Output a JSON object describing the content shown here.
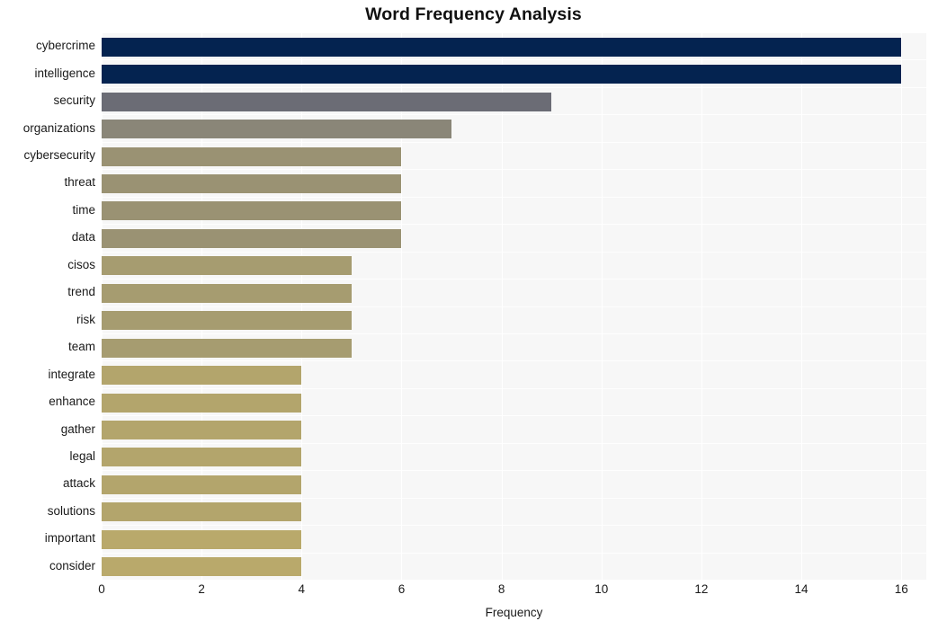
{
  "chart_data": {
    "type": "bar",
    "orientation": "horizontal",
    "title": "Word Frequency Analysis",
    "xlabel": "Frequency",
    "ylabel": "",
    "xlim": [
      0,
      16.5
    ],
    "xticks": [
      0,
      2,
      4,
      6,
      8,
      10,
      12,
      14,
      16
    ],
    "xtick_labels": [
      "0",
      "2",
      "4",
      "6",
      "8",
      "10",
      "12",
      "14",
      "16"
    ],
    "grid": true,
    "legend": null,
    "categories": [
      "cybercrime",
      "intelligence",
      "security",
      "organizations",
      "cybersecurity",
      "threat",
      "time",
      "data",
      "cisos",
      "trend",
      "risk",
      "team",
      "integrate",
      "enhance",
      "gather",
      "legal",
      "attack",
      "solutions",
      "important",
      "consider"
    ],
    "values": [
      16,
      16,
      9,
      7,
      6,
      6,
      6,
      6,
      5,
      5,
      5,
      5,
      4,
      4,
      4,
      4,
      4,
      4,
      4,
      4
    ],
    "bar_colors": [
      "#042350",
      "#042350",
      "#6b6c75",
      "#8a8678",
      "#9a9273",
      "#9a9273",
      "#9a9273",
      "#9a9273",
      "#a69c70",
      "#a69c70",
      "#a69c70",
      "#a69c70",
      "#b3a56c",
      "#b3a56c",
      "#b3a56c",
      "#b3a56c",
      "#b3a56c",
      "#b3a56c",
      "#b9a96b",
      "#b9a96b"
    ],
    "plot_background": "#f7f7f7",
    "figure_background": "#ffffff",
    "gridline_color": "#ffffff"
  }
}
